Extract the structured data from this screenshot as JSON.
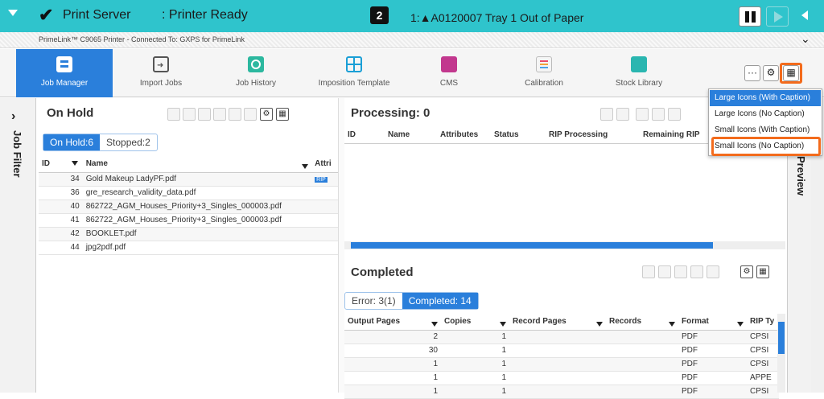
{
  "topbar": {
    "title": "Print Server",
    "state": ": Printer Ready",
    "badge_count": "2",
    "alert": "1:▲A0120007 Tray 1 Out of Paper"
  },
  "subbar": {
    "text": "PrimeLink™ C9065 Printer - Connected To: GXPS for PrimeLink"
  },
  "toolbar": {
    "items": [
      {
        "label": "Job Manager"
      },
      {
        "label": "Import Jobs"
      },
      {
        "label": "Job History"
      },
      {
        "label": "Imposition Template"
      },
      {
        "label": "CMS"
      },
      {
        "label": "Calibration"
      },
      {
        "label": "Stock Library"
      }
    ]
  },
  "filter": {
    "label": "Job Filter"
  },
  "onhold": {
    "title": "On Hold",
    "tabs": [
      "On Hold:6",
      "Stopped:2"
    ],
    "columns": [
      "ID",
      "Name",
      "Attri"
    ],
    "rows": [
      {
        "id": "34",
        "name": "Gold Makeup LadyPF.pdf",
        "attr": "RIP"
      },
      {
        "id": "36",
        "name": "gre_research_validity_data.pdf",
        "attr": ""
      },
      {
        "id": "40",
        "name": "862722_AGM_Houses_Priority+3_Singles_000003.pdf",
        "attr": ""
      },
      {
        "id": "41",
        "name": "862722_AGM_Houses_Priority+3_Singles_000003.pdf",
        "attr": ""
      },
      {
        "id": "42",
        "name": "BOOKLET.pdf",
        "attr": ""
      },
      {
        "id": "44",
        "name": "jpg2pdf.pdf",
        "attr": ""
      }
    ]
  },
  "processing": {
    "title": "Processing: 0",
    "columns": [
      "ID",
      "Name",
      "Attributes",
      "Status",
      "RIP Processing",
      "Remaining RIP"
    ]
  },
  "completed": {
    "title": "Completed",
    "tabs": [
      "Error: 3(1)",
      "Completed: 14"
    ],
    "columns": [
      "Output Pages",
      "Copies",
      "Record Pages",
      "Records",
      "Format",
      "RIP Ty"
    ],
    "rows": [
      {
        "output": "2",
        "copies": "1",
        "record_pages": "",
        "records": "",
        "format": "PDF",
        "rip": "CPSI"
      },
      {
        "output": "30",
        "copies": "1",
        "record_pages": "",
        "records": "",
        "format": "PDF",
        "rip": "CPSI"
      },
      {
        "output": "1",
        "copies": "1",
        "record_pages": "",
        "records": "",
        "format": "PDF",
        "rip": "CPSI"
      },
      {
        "output": "1",
        "copies": "1",
        "record_pages": "",
        "records": "",
        "format": "PDF",
        "rip": "APPE"
      },
      {
        "output": "1",
        "copies": "1",
        "record_pages": "",
        "records": "",
        "format": "PDF",
        "rip": "CPSI"
      }
    ]
  },
  "preview": {
    "label": "Preview"
  },
  "dropdown": {
    "options": [
      "Large Icons (With Caption)",
      "Large Icons (No Caption)",
      "Small Icons (With Caption)",
      "Small Icons (No Caption)"
    ],
    "selected": "Large Icons (With Caption)"
  },
  "colors": {
    "teal": "#2fc4cc",
    "accent": "#2a7fdb",
    "highlight": "#f36b1c"
  }
}
